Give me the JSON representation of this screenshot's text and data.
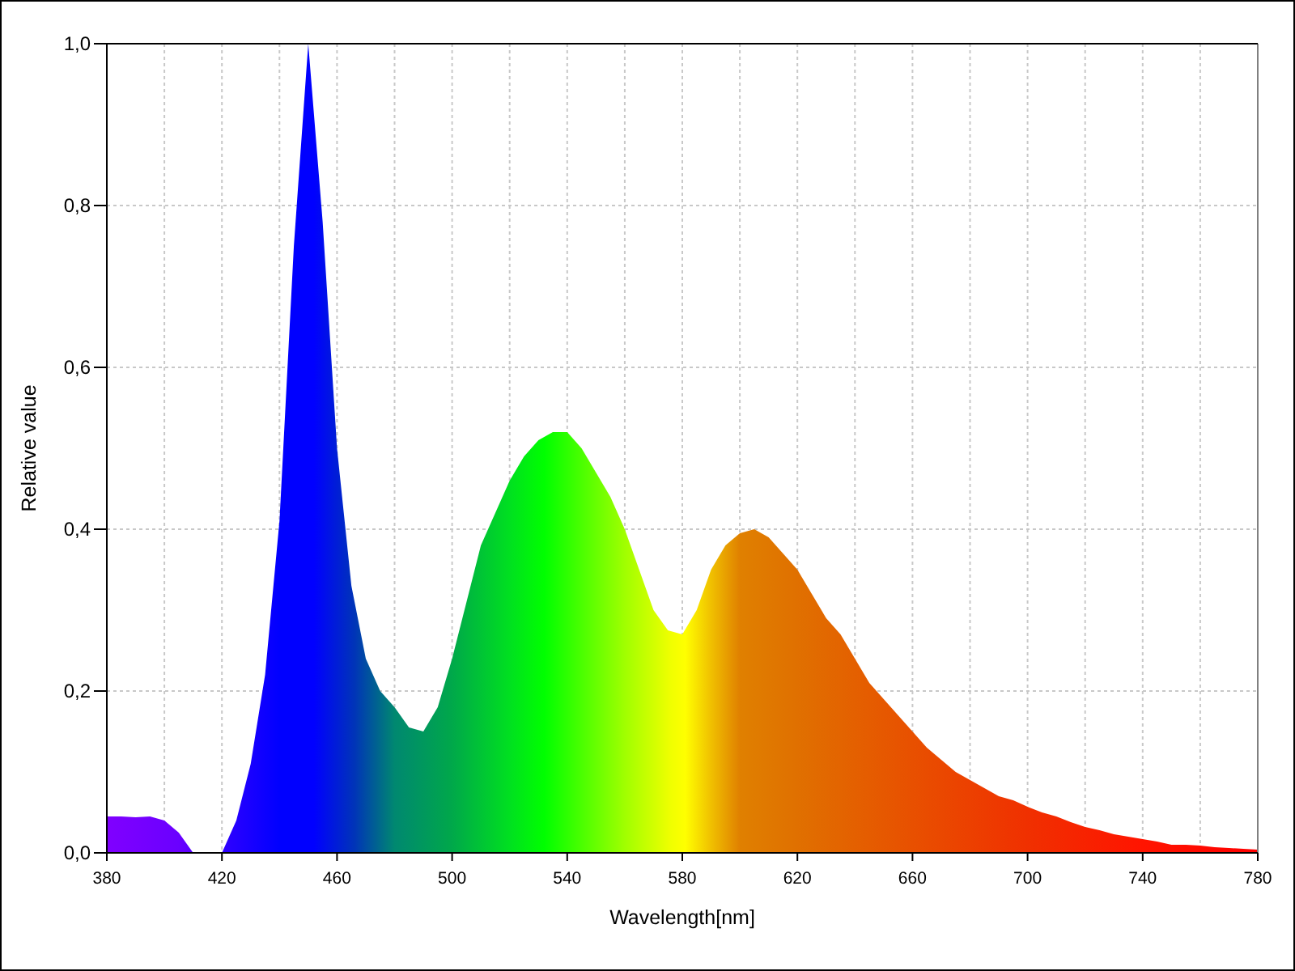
{
  "chart": {
    "chart_data": {
      "type": "area",
      "xlabel": "Wavelength[nm]",
      "ylabel": "Relative value",
      "x": [
        380,
        385,
        390,
        395,
        400,
        405,
        410,
        415,
        420,
        425,
        430,
        435,
        440,
        445,
        450,
        455,
        460,
        465,
        470,
        475,
        480,
        485,
        490,
        495,
        500,
        505,
        510,
        515,
        520,
        525,
        530,
        535,
        540,
        545,
        550,
        555,
        560,
        565,
        570,
        575,
        580,
        585,
        590,
        595,
        600,
        605,
        610,
        615,
        620,
        625,
        630,
        635,
        640,
        645,
        650,
        655,
        660,
        665,
        670,
        675,
        680,
        685,
        690,
        695,
        700,
        705,
        710,
        715,
        720,
        725,
        730,
        735,
        740,
        745,
        750,
        755,
        760,
        765,
        770,
        775,
        780
      ],
      "series": [
        {
          "values": [
            0.045,
            0.045,
            0.044,
            0.045,
            0.04,
            0.025,
            0,
            0,
            0,
            0.04,
            0.11,
            0.22,
            0.41,
            0.75,
            1.0,
            0.78,
            0.5,
            0.33,
            0.24,
            0.2,
            0.18,
            0.155,
            0.15,
            0.18,
            0.24,
            0.31,
            0.38,
            0.42,
            0.46,
            0.49,
            0.51,
            0.52,
            0.52,
            0.5,
            0.47,
            0.44,
            0.4,
            0.35,
            0.3,
            0.275,
            0.27,
            0.3,
            0.35,
            0.38,
            0.395,
            0.4,
            0.39,
            0.37,
            0.35,
            0.32,
            0.29,
            0.27,
            0.24,
            0.21,
            0.19,
            0.17,
            0.15,
            0.13,
            0.115,
            0.1,
            0.09,
            0.08,
            0.07,
            0.065,
            0.057,
            0.05,
            0.045,
            0.038,
            0.032,
            0.028,
            0.023,
            0.02,
            0.017,
            0.014,
            0.01,
            0.01,
            0.009,
            0.007,
            0.006,
            0.005,
            0.004
          ]
        }
      ],
      "xlim": [
        380,
        780
      ],
      "ylim": [
        0,
        1
      ],
      "grid": true,
      "xticks": [
        380,
        420,
        460,
        500,
        540,
        580,
        620,
        660,
        700,
        740,
        780
      ],
      "yticks": [
        {
          "value": 0,
          "label": "0,0"
        },
        {
          "value": 0.2,
          "label": "0,2"
        },
        {
          "value": 0.4,
          "label": "0,4"
        },
        {
          "value": 0.6,
          "label": "0,6"
        },
        {
          "value": 0.8,
          "label": "0,8"
        },
        {
          "value": 1,
          "label": "1,0"
        }
      ]
    }
  }
}
